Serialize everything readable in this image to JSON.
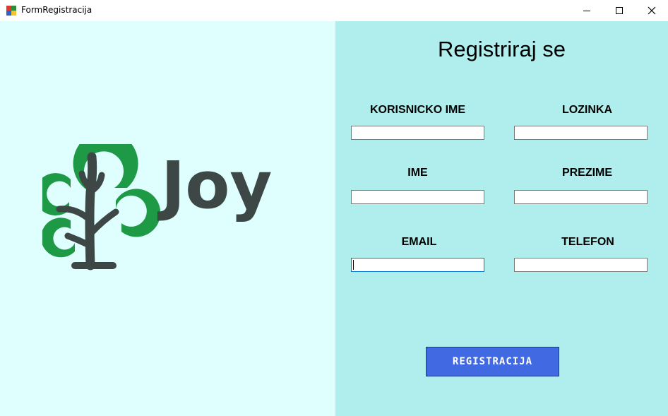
{
  "window": {
    "title": "FormRegistracija",
    "controls": {
      "minimize_icon": "minimize-icon",
      "maximize_icon": "maximize-icon",
      "close_icon": "close-icon"
    }
  },
  "branding": {
    "logo_text": "Joy",
    "logo_icon": "tree-icon",
    "tree_color": "#1e9a46",
    "text_color": "#3d4846"
  },
  "form": {
    "heading": "Registriraj se",
    "fields": {
      "username": {
        "label": "KORISNICKO IME",
        "value": ""
      },
      "password": {
        "label": "LOZINKA",
        "value": ""
      },
      "first_name": {
        "label": "IME",
        "value": ""
      },
      "last_name": {
        "label": "PREZIME",
        "value": ""
      },
      "email": {
        "label": "EMAIL",
        "value": ""
      },
      "phone": {
        "label": "TELEFON",
        "value": ""
      }
    },
    "submit_label": "REGISTRACIJA"
  },
  "colors": {
    "left_bg": "#dfffff",
    "right_bg": "#b0eded",
    "button_bg": "#4169e1"
  }
}
